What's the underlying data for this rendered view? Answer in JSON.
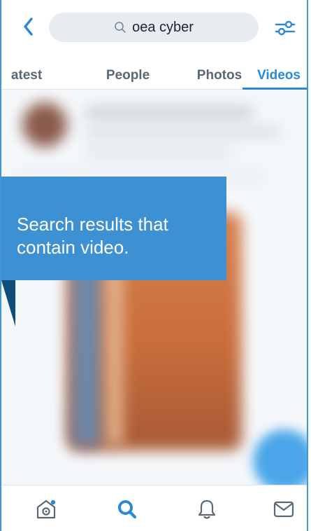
{
  "search": {
    "query": "oea cyber"
  },
  "tabs": [
    {
      "label": "atest"
    },
    {
      "label": "People"
    },
    {
      "label": "Photos"
    },
    {
      "label": "Videos"
    }
  ],
  "callout": {
    "text": "Search results that contain video."
  },
  "colors": {
    "accent": "#2b8ad6",
    "callout_bg": "#3d91d2",
    "tab_inactive": "#5a6874"
  },
  "icons": {
    "back": "chevron-left-icon",
    "search": "search-icon",
    "filter": "filter-icon",
    "home": "home-icon",
    "search_nav": "search-icon",
    "notifications": "bell-icon",
    "messages": "mail-icon"
  }
}
